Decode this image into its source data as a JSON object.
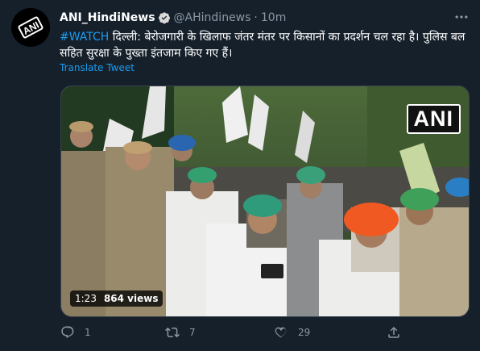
{
  "author": {
    "name": "ANI_HindiNews",
    "handle": "@AHindinews",
    "separator": "·",
    "time": "10m",
    "avatar_text": "ANI"
  },
  "tweet": {
    "hashtag": "#WATCH",
    "body": " दिल्ली: बेरोजगारी के खिलाफ जंतर मंतर पर किसानों का प्रदर्शन चल रहा है। पुलिस बल सहित सुरक्षा के पुख्ता इंतजाम किए गए हैं।",
    "translate_label": "Translate Tweet"
  },
  "video": {
    "watermark": "ANI",
    "duration": "1:23",
    "views": "864 views"
  },
  "actions": {
    "reply_count": "1",
    "retweet_count": "7",
    "like_count": "29",
    "share_count": ""
  },
  "colors": {
    "background": "#15202b",
    "accent": "#1d9bf0",
    "muted": "#8b98a5"
  },
  "icons": [
    "ani-avatar-icon",
    "verified-badge-icon",
    "more-icon",
    "reply-icon",
    "retweet-icon",
    "like-icon",
    "share-icon"
  ]
}
